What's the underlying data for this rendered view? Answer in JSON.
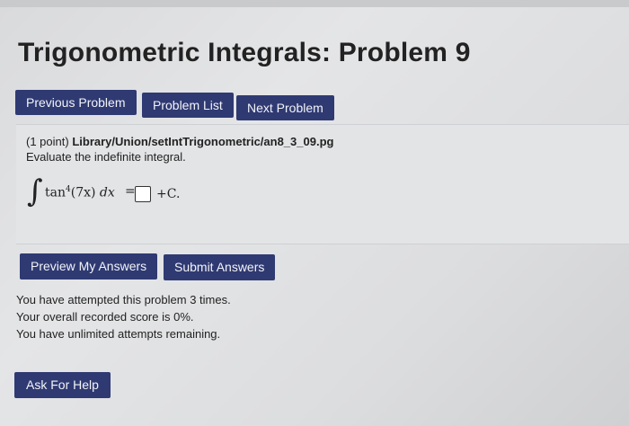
{
  "header": {
    "title": "Trigonometric Integrals: Problem 9"
  },
  "nav": {
    "previous_label": "Previous Problem",
    "list_label": "Problem List",
    "next_label": "Next Problem"
  },
  "problem": {
    "points": "(1 point)",
    "path": "Library/Union/setIntTrigonometric/an8_3_09.pg",
    "instruction": "Evaluate the indefinite integral.",
    "integral_sign": "∫",
    "integrand_func": "tan",
    "integrand_power": "4",
    "integrand_arg": "(7x)",
    "differential": "dx",
    "equals": "=",
    "answer_value": "",
    "constant": "+C."
  },
  "actions": {
    "preview_label": "Preview My Answers",
    "submit_label": "Submit Answers"
  },
  "status": {
    "attempts": "You have attempted this problem 3 times.",
    "score": "Your overall recorded score is 0%.",
    "remaining": "You have unlimited attempts remaining."
  },
  "help": {
    "label": "Ask For Help"
  },
  "colors": {
    "button_bg": "#2f3a72",
    "button_text": "#f2f3f8",
    "page_bg": "#dcdddf"
  }
}
